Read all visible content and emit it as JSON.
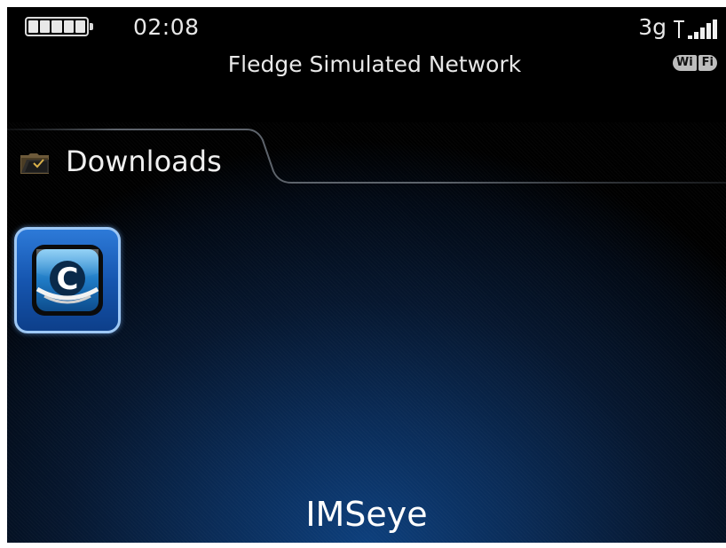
{
  "status_bar": {
    "time": "02:08",
    "network_name": "Fledge Simulated Network",
    "network_type": "3g",
    "signal_icon": "signal-bars-icon",
    "battery_icon": "battery-icon",
    "wifi_left": "Wi",
    "wifi_right": "Fi"
  },
  "folder": {
    "title": "Downloads",
    "icon": "folder-icon"
  },
  "apps": [
    {
      "icon": "imseye-app-icon",
      "selected": true
    }
  ],
  "focused_app_label": "IMSeye",
  "colors": {
    "background_top": "#000000",
    "background_glow": "#0d3f7c",
    "selection_border": "#9ec8f5",
    "text": "#f0f0f0"
  }
}
